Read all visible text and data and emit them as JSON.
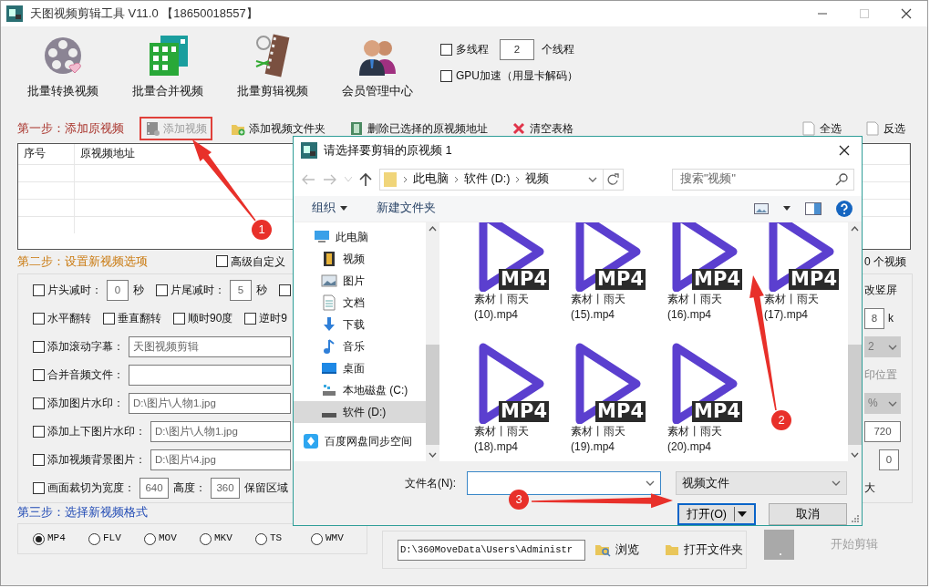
{
  "window": {
    "title": "天图视频剪辑工具 V11.0 【18650018557】"
  },
  "toolbar": [
    {
      "kind": "convert",
      "label": "批量转换视频"
    },
    {
      "kind": "merge",
      "label": "批量合并视频"
    },
    {
      "kind": "cut",
      "label": "批量剪辑视频"
    },
    {
      "kind": "member",
      "label": "会员管理中心"
    }
  ],
  "options": [
    {
      "label": "多线程",
      "checked": false,
      "value": "2",
      "suffix": "个线程"
    },
    {
      "label": "GPU加速（用显卡解码）",
      "checked": false
    }
  ],
  "step1": {
    "title": "第一步：添加原视频",
    "actions": [
      {
        "kind": "add",
        "label": "添加视频",
        "disabled": true,
        "highlighted": true
      },
      {
        "kind": "folder",
        "label": "添加视频文件夹",
        "disabled": false,
        "highlighted": false
      },
      {
        "kind": "delete",
        "label": "删除已选择的原视频地址",
        "disabled": false,
        "highlighted": false
      },
      {
        "kind": "clear",
        "label": "清空表格",
        "disabled": false,
        "highlighted": false
      },
      {
        "kind": "select",
        "label": "全选",
        "disabled": false,
        "highlighted": false
      },
      {
        "kind": "select",
        "label": "反选",
        "disabled": false,
        "highlighted": false
      }
    ]
  },
  "table": {
    "columns": [
      "序号",
      "原视频地址"
    ],
    "count": "0 个视频"
  },
  "step2": {
    "title": "第二步：设置新视频选项",
    "advanced": {
      "label": "高级自定义",
      "checked": false
    },
    "rows": [
      {
        "items": [
          {
            "kind": "check",
            "label": "片头减时：",
            "checked": false
          },
          {
            "kind": "field",
            "value": "0"
          },
          {
            "kind": "text",
            "text": "秒"
          },
          {
            "kind": "check",
            "label": "片尾减时：",
            "checked": false
          },
          {
            "kind": "field",
            "value": "5"
          },
          {
            "kind": "text",
            "text": "秒"
          },
          {
            "kind": "check",
            "checked": false
          }
        ],
        "right": {
          "kind": "text",
          "text": "改竖屏"
        }
      },
      {
        "items": [
          {
            "kind": "check",
            "label": "水平翻转",
            "checked": false
          },
          {
            "kind": "check",
            "label": "垂直翻转",
            "checked": false
          },
          {
            "kind": "check",
            "label": "顺时90度",
            "checked": false
          },
          {
            "kind": "check",
            "label": "逆时9",
            "checked": false
          }
        ],
        "right": {
          "kind": "field",
          "value": "8",
          "suffix": "k"
        }
      },
      {
        "items": [
          {
            "kind": "check",
            "label": "添加滚动字幕：",
            "checked": false
          },
          {
            "kind": "field",
            "value": "天图视频剪辑"
          }
        ],
        "right": {
          "kind": "select",
          "value": "2",
          "disabled": true
        }
      },
      {
        "items": [
          {
            "kind": "check",
            "label": "合并音频文件：",
            "checked": false
          },
          {
            "kind": "field"
          }
        ],
        "right": {
          "kind": "text",
          "text": "印位置",
          "disabled": true
        }
      },
      {
        "items": [
          {
            "kind": "check",
            "label": "添加图片水印：",
            "checked": false
          },
          {
            "kind": "field",
            "value": "D:\\图片\\人物1.jpg"
          }
        ],
        "right": {
          "kind": "select",
          "value": "%",
          "disabled": true
        }
      },
      {
        "items": [
          {
            "kind": "check",
            "label": "添加上下图片水印：",
            "checked": false
          },
          {
            "kind": "field",
            "value": "D:\\图片\\人物1.jpg"
          }
        ],
        "right": {
          "kind": "field",
          "value": "720"
        }
      },
      {
        "items": [
          {
            "kind": "check",
            "label": "添加视频背景图片：",
            "checked": false
          },
          {
            "kind": "field",
            "value": "D:\\图片\\4.jpg"
          }
        ],
        "right": {
          "kind": "field",
          "value": "0"
        }
      },
      {
        "items": [
          {
            "kind": "check",
            "label": "画面裁切为宽度：",
            "checked": false
          },
          {
            "kind": "field",
            "value": "640"
          },
          {
            "kind": "text",
            "text": "高度："
          },
          {
            "kind": "field",
            "value": "360"
          },
          {
            "kind": "text",
            "text": "保留区域"
          }
        ],
        "right": {
          "kind": "text",
          "text": "大"
        }
      }
    ]
  },
  "step3": {
    "title": "第三步：选择新视频格式",
    "formats": [
      {
        "label": "MP4",
        "selected": true
      },
      {
        "label": "FLV",
        "selected": false
      },
      {
        "label": "MOV",
        "selected": false
      },
      {
        "label": "MKV",
        "selected": false
      },
      {
        "label": "TS",
        "selected": false
      },
      {
        "label": "WMV",
        "selected": false
      }
    ],
    "output_path": "D:\\360MoveData\\Users\\Administr",
    "browse": "浏览",
    "open_folder": "打开文件夹",
    "start": {
      "label": "开始剪辑",
      "disabled": true
    }
  },
  "dialog": {
    "title": "请选择要剪辑的原视频 1",
    "path": [
      "此电脑",
      "软件 (D:)",
      "视频"
    ],
    "search": {
      "placeholder": "搜索\"视频\""
    },
    "commands": [
      {
        "label": "组织",
        "dropdown": true
      },
      {
        "label": "新建文件夹",
        "dropdown": false
      }
    ],
    "nav_pane": [
      {
        "kind": "computer",
        "label": "此电脑",
        "selected": false,
        "children": [
          {
            "kind": "video",
            "label": "视频",
            "selected": false
          },
          {
            "kind": "pictures",
            "label": "图片",
            "selected": false
          },
          {
            "kind": "documents",
            "label": "文档",
            "selected": false
          },
          {
            "kind": "downloads",
            "label": "下载",
            "selected": false
          },
          {
            "kind": "music",
            "label": "音乐",
            "selected": false
          },
          {
            "kind": "desktop",
            "label": "桌面",
            "selected": false
          },
          {
            "kind": "system-drive",
            "label": "本地磁盘 (C:)",
            "selected": false
          },
          {
            "kind": "drive",
            "label": "软件 (D:)",
            "selected": true
          }
        ]
      },
      {
        "kind": "cloud",
        "label": "百度网盘同步空间",
        "selected": false
      }
    ],
    "files": [
      {
        "name": "素材丨雨天 (10).mp4",
        "badge": "MP4"
      },
      {
        "name": "素材丨雨天 (15).mp4",
        "badge": "MP4"
      },
      {
        "name": "素材丨雨天 (16).mp4",
        "badge": "MP4"
      },
      {
        "name": "素材丨雨天 (17).mp4",
        "badge": "MP4"
      },
      {
        "name": "素材丨雨天 (18).mp4",
        "badge": "MP4"
      },
      {
        "name": "素材丨雨天 (19).mp4",
        "badge": "MP4"
      },
      {
        "name": "素材丨雨天 (20).mp4",
        "badge": "MP4"
      }
    ],
    "file_name": {
      "label": "文件名(N):"
    },
    "file_type": "视频文件",
    "buttons": [
      {
        "kind": "split",
        "label": "打开(O)",
        "focused": true
      },
      {
        "kind": "plain",
        "label": "取消",
        "focused": false
      }
    ]
  },
  "annotations": [
    {
      "label": "1"
    },
    {
      "label": "2"
    },
    {
      "label": "3"
    }
  ]
}
